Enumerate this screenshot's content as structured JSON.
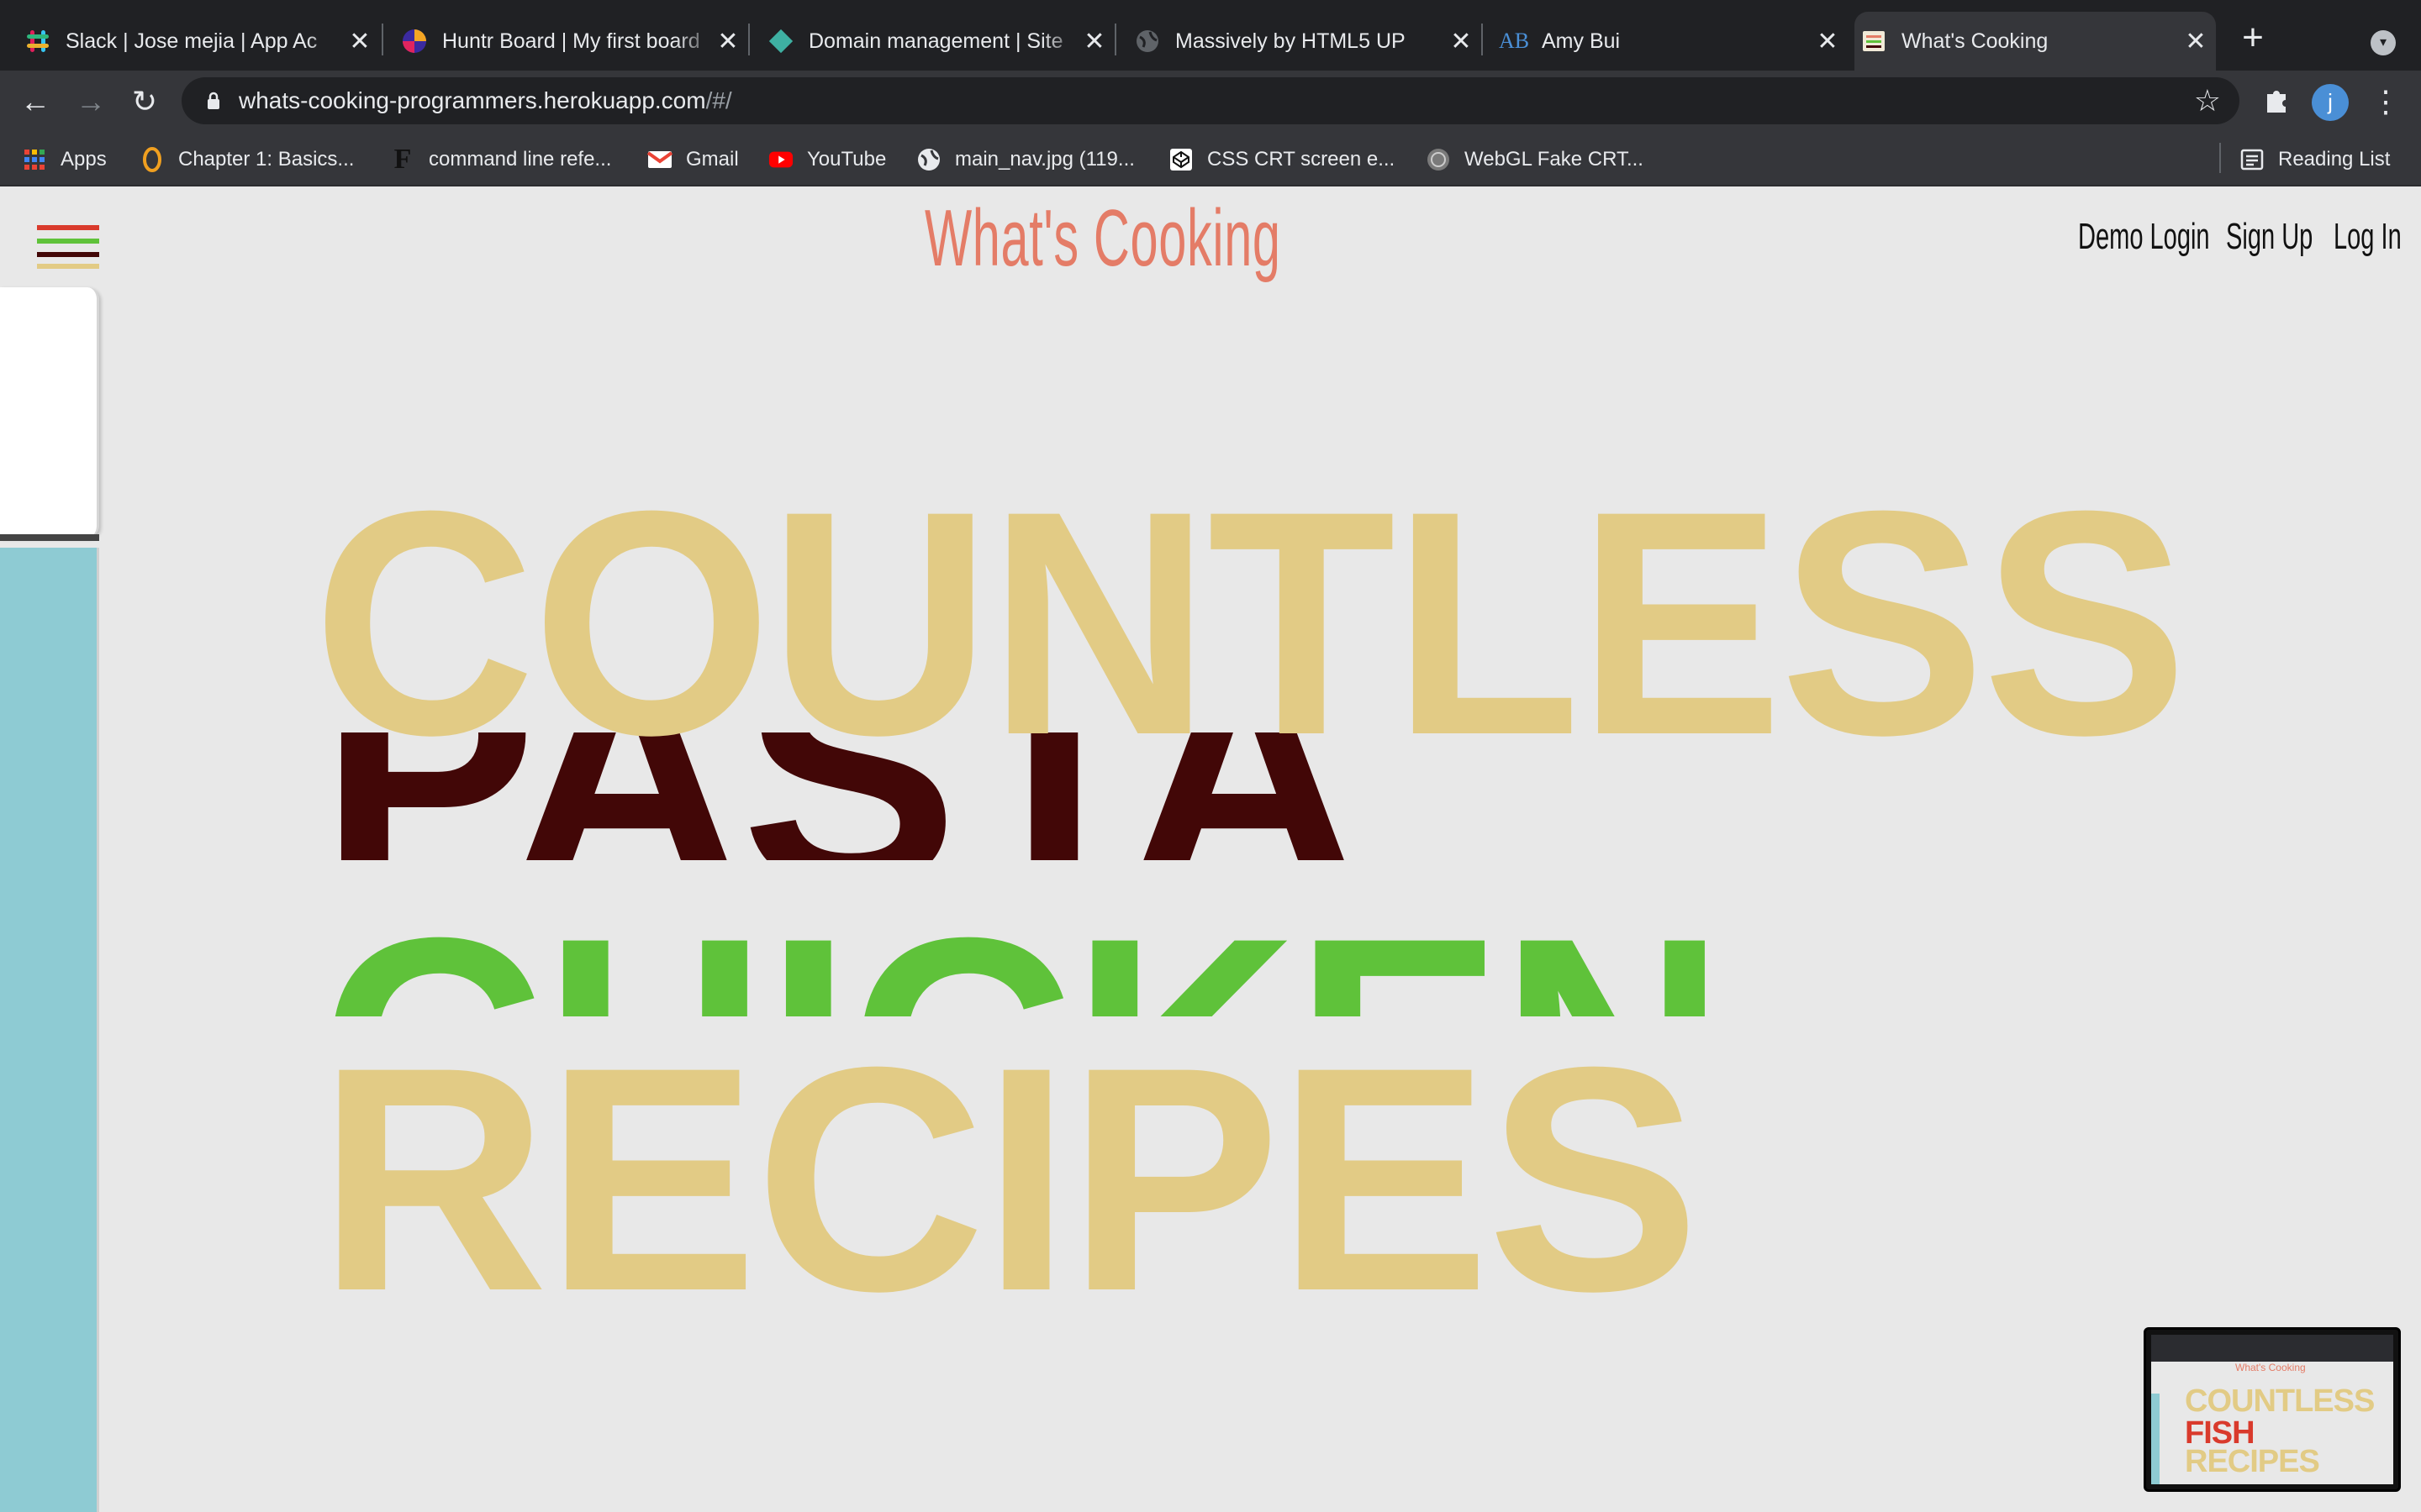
{
  "browser": {
    "tabs": [
      {
        "title": "Slack | Jose mejia | App Ac",
        "icon": "slack-icon"
      },
      {
        "title": "Huntr Board | My first board",
        "icon": "huntr-icon"
      },
      {
        "title": "Domain management | Site",
        "icon": "netlify-icon"
      },
      {
        "title": "Massively by HTML5 UP",
        "icon": "globe-icon"
      },
      {
        "title": "Amy Bui",
        "icon": "ab-icon"
      },
      {
        "title": "What's Cooking",
        "icon": "page-icon",
        "active": true
      }
    ],
    "url_host": "whats-cooking-programmers.herokuapp.com",
    "url_path": "/#/",
    "avatar_letter": "j",
    "bookmarks": [
      {
        "label": "Apps",
        "icon": "apps-grid-icon"
      },
      {
        "label": "Chapter 1: Basics...",
        "icon": "chapter-icon"
      },
      {
        "label": "command line refe...",
        "icon": "f-icon"
      },
      {
        "label": "Gmail",
        "icon": "gmail-icon"
      },
      {
        "label": "YouTube",
        "icon": "youtube-icon"
      },
      {
        "label": "main_nav.jpg (119...",
        "icon": "globe-icon"
      },
      {
        "label": "CSS CRT screen e...",
        "icon": "codepen-icon"
      },
      {
        "label": "WebGL Fake CRT...",
        "icon": "webgl-icon"
      }
    ],
    "reading_list": "Reading List"
  },
  "site": {
    "logo": "What's Cooking",
    "nav": {
      "demo_login": "Demo Login",
      "sign_up": "Sign Up",
      "log_in": "Log In"
    },
    "hero": {
      "top_word": "COUNTLESS",
      "rolling_words": [
        "PASTA",
        "CHICKEN"
      ],
      "bottom_word": "RECIPES"
    },
    "colors": {
      "logo": "#e47c67",
      "countless": "#e2cb85",
      "pasta": "#420707",
      "chicken": "#5fc23a",
      "recipes": "#e2cb85",
      "teal": "#8ecbd3",
      "fish": "#d93a2c",
      "background": "#e8e8e8"
    }
  },
  "pip_preview": {
    "logo": "What's Cooking",
    "lines": [
      "COUNTLESS",
      "FISH",
      "RECIPES"
    ]
  }
}
